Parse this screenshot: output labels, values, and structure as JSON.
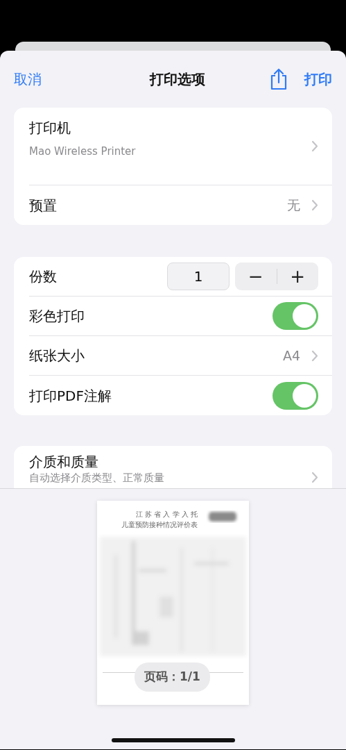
{
  "nav": {
    "cancel": "取消",
    "title": "打印选项",
    "print": "打印"
  },
  "printer_group": [
    {
      "kind": "detail",
      "label": "打印机",
      "subtitle": "Mao Wireless Printer"
    },
    {
      "kind": "value",
      "label": "预置",
      "value": "无"
    }
  ],
  "options_group": [
    {
      "kind": "stepper",
      "label": "份数",
      "value": "1",
      "minus": "−",
      "plus": "+"
    },
    {
      "kind": "toggle",
      "label": "彩色打印",
      "on": true
    },
    {
      "kind": "value",
      "label": "纸张大小",
      "value": "A4"
    },
    {
      "kind": "toggle",
      "label": "打印PDF注解",
      "on": true
    }
  ],
  "media_group": [
    {
      "kind": "detail",
      "label": "介质和质量",
      "subtitle": "自动选择介质类型、正常质量"
    }
  ],
  "preview": {
    "header_lines": [
      "江 苏 省 入 学 入 托",
      "儿童预防接种情况评价表"
    ],
    "page_label": "页码：1/1"
  }
}
